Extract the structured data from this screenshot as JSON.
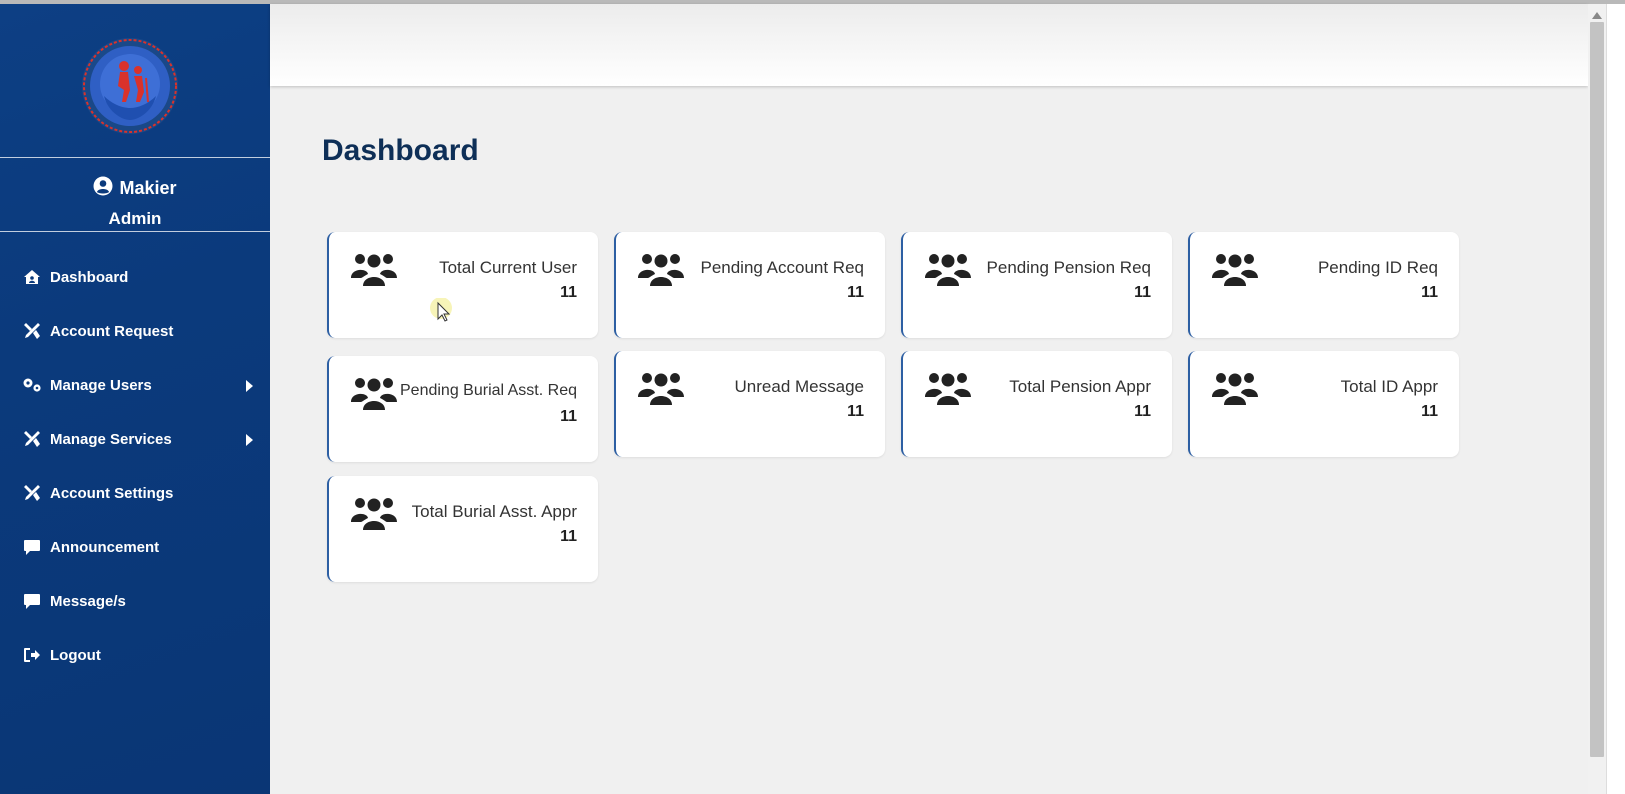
{
  "sidebar": {
    "user": {
      "name": "Makier",
      "role": "Admin"
    },
    "items": [
      {
        "label": "Dashboard",
        "icon": "home-icon"
      },
      {
        "label": "Account Request",
        "icon": "tools-icon"
      },
      {
        "label": "Manage Users",
        "icon": "cogs-icon",
        "has_submenu": true
      },
      {
        "label": "Manage Services",
        "icon": "tools-icon",
        "has_submenu": true
      },
      {
        "label": "Account Settings",
        "icon": "tools-icon"
      },
      {
        "label": "Announcement",
        "icon": "comment-icon"
      },
      {
        "label": "Message/s",
        "icon": "comment-icon"
      },
      {
        "label": "Logout",
        "icon": "sign-out-icon"
      }
    ]
  },
  "main": {
    "title": "Dashboard",
    "cards": [
      {
        "label": "Total Current User",
        "value": "11"
      },
      {
        "label": "Pending Account Req",
        "value": "11"
      },
      {
        "label": "Pending Pension Req",
        "value": "11"
      },
      {
        "label": "Pending ID Req",
        "value": "11"
      },
      {
        "label": "Pending Burial Asst. Req",
        "value": "11"
      },
      {
        "label": "Unread Message",
        "value": "11"
      },
      {
        "label": "Total Pension Appr",
        "value": "11"
      },
      {
        "label": "Total ID Appr",
        "value": "11"
      },
      {
        "label": "Total Burial Asst. Appr",
        "value": "11"
      }
    ]
  },
  "colors": {
    "sidebar": "#0b3a7c",
    "title": "#0e2f57",
    "card_border": "#2d5fa3",
    "logo_red": "#d9322b",
    "logo_blue": "#2f5fc4"
  }
}
